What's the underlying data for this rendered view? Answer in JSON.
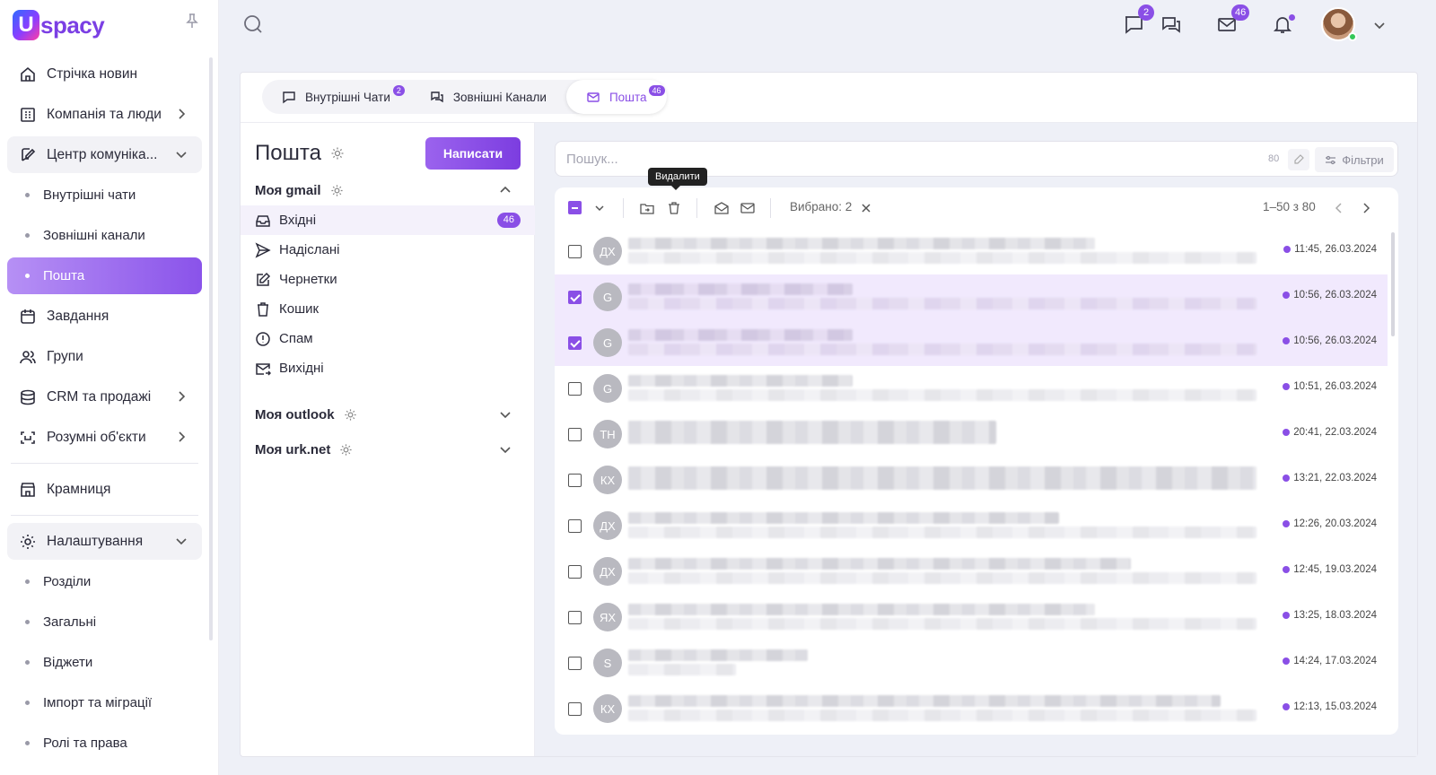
{
  "app": {
    "logo_letter": "U",
    "logo_text": "spacy"
  },
  "sidebar": {
    "items": [
      {
        "label": "Стрічка новин",
        "icon": "home-icon"
      },
      {
        "label": "Компанія та люди",
        "icon": "building-icon"
      },
      {
        "label": "Центр комуніка...",
        "icon": "chat-edit-icon"
      },
      {
        "label": "Внутрішні чати"
      },
      {
        "label": "Зовнішні канали"
      },
      {
        "label": "Пошта"
      },
      {
        "label": "Завдання",
        "icon": "calendar-icon"
      },
      {
        "label": "Групи",
        "icon": "users-icon"
      },
      {
        "label": "CRM та продажі",
        "icon": "database-icon"
      },
      {
        "label": "Розумні об'єкти",
        "icon": "scan-icon"
      },
      {
        "label": "Крамниця",
        "icon": "store-icon"
      },
      {
        "label": "Налаштування",
        "icon": "gear-icon"
      },
      {
        "label": "Розділи"
      },
      {
        "label": "Загальні"
      },
      {
        "label": "Віджети"
      },
      {
        "label": "Імпорт та міграції"
      },
      {
        "label": "Ролі та права"
      }
    ]
  },
  "topbar": {
    "chat_badge": "2",
    "mail_badge": "46"
  },
  "tabs": [
    {
      "label": "Внутрішні Чати",
      "badge": "2"
    },
    {
      "label": "Зовнішні Канали"
    },
    {
      "label": "Пошта",
      "badge": "46"
    }
  ],
  "mail": {
    "title": "Пошта",
    "compose_label": "Написати",
    "accounts": [
      {
        "name": "Моя gmail"
      },
      {
        "name": "Моя outlook"
      },
      {
        "name": "Моя urk.net"
      }
    ],
    "folders": [
      {
        "label": "Вхідні",
        "count": "46",
        "icon": "inbox-icon"
      },
      {
        "label": "Надіслані",
        "icon": "send-icon"
      },
      {
        "label": "Чернетки",
        "icon": "edit-icon"
      },
      {
        "label": "Кошик",
        "icon": "trash-icon"
      },
      {
        "label": "Спам",
        "icon": "alert-circle-icon"
      },
      {
        "label": "Вихідні",
        "icon": "outbox-icon"
      }
    ]
  },
  "search": {
    "placeholder": "Пошук...",
    "count": "80",
    "filters_label": "Фільтри"
  },
  "toolbar": {
    "tooltip": "Видалити",
    "selected_label": "Вибрано: 2",
    "pagination": "1–50 з 80"
  },
  "messages": [
    {
      "avatar": "ДХ",
      "date": "11:45, 26.03.2024",
      "selected": false
    },
    {
      "avatar": "G",
      "date": "10:56, 26.03.2024",
      "selected": true
    },
    {
      "avatar": "G",
      "date": "10:56, 26.03.2024",
      "selected": true
    },
    {
      "avatar": "G",
      "date": "10:51, 26.03.2024",
      "selected": false
    },
    {
      "avatar": "ТН",
      "date": "20:41, 22.03.2024",
      "selected": false
    },
    {
      "avatar": "КХ",
      "date": "13:21, 22.03.2024",
      "selected": false
    },
    {
      "avatar": "ДХ",
      "date": "12:26, 20.03.2024",
      "selected": false
    },
    {
      "avatar": "ДХ",
      "date": "12:45, 19.03.2024",
      "selected": false
    },
    {
      "avatar": "ЯХ",
      "date": "13:25, 18.03.2024",
      "selected": false
    },
    {
      "avatar": "S",
      "date": "14:24, 17.03.2024",
      "selected": false
    },
    {
      "avatar": "КХ",
      "date": "12:13, 15.03.2024",
      "selected": false
    }
  ],
  "colors": {
    "accent": "#8a4fe6",
    "selected_row": "#f1e9fd",
    "online": "#34c759"
  }
}
